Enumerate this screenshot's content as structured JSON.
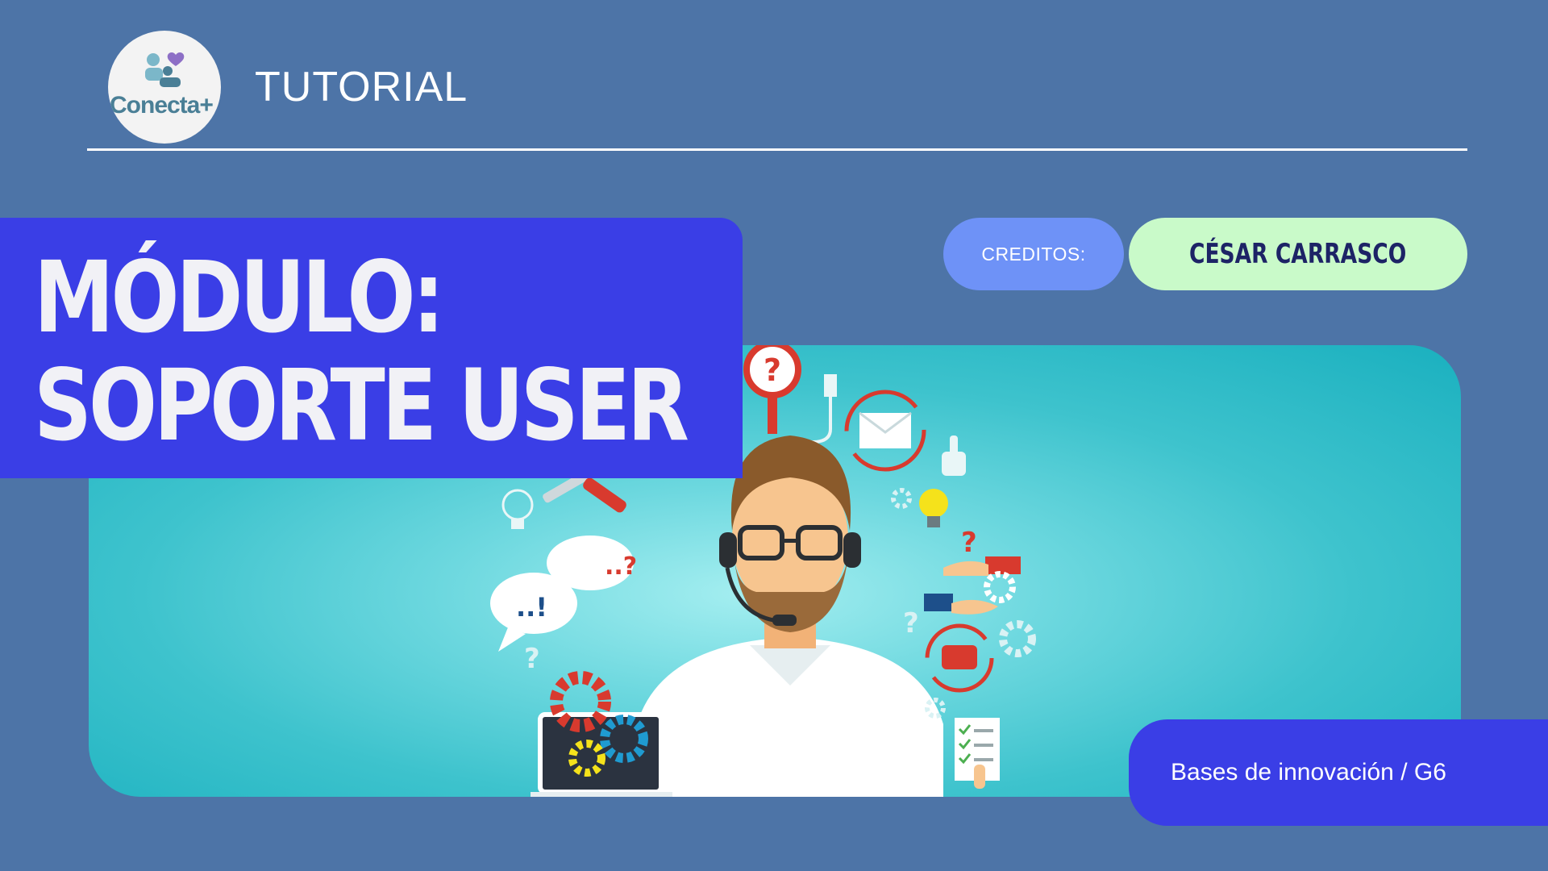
{
  "header": {
    "logo_text": "Conecta+",
    "label": "TUTORIAL"
  },
  "title": {
    "line1": "MÓDULO:",
    "line2": "SOPORTE USER"
  },
  "credits": {
    "label": "CREDITOS:",
    "author": "CÉSAR CARRASCO"
  },
  "footer": {
    "course": "Bases de innovación / G6"
  },
  "colors": {
    "background": "#4d74a7",
    "title_box": "#3a3ee6",
    "credits_pill": "#6e92f7",
    "author_pill": "#c9fac9",
    "hero_teal": "#3ec3cd"
  },
  "illustration": {
    "subject": "support-agent-with-headset",
    "icons": [
      "question-magnifier-icon",
      "usb-icon",
      "email-cycle-icon",
      "thumbs-up-icon",
      "wrench-screwdriver-icon",
      "lightbulb-icon",
      "chat-bubbles-icon",
      "handshake-icon",
      "gear-icon",
      "phone-cycle-icon",
      "laptop-gears-icon",
      "checklist-icon"
    ]
  }
}
